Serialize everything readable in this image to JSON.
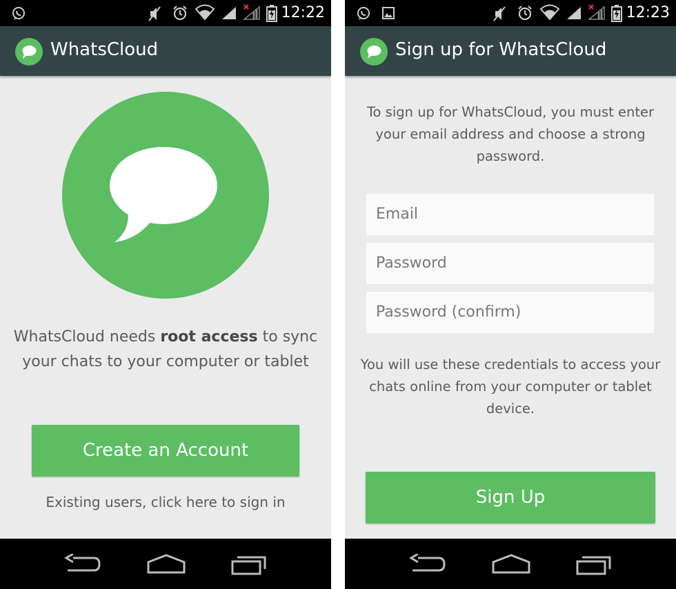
{
  "colors": {
    "accent_green": "#5cbd63",
    "action_bar": "#324446",
    "background": "#ebebeb",
    "field_background": "#fafafa"
  },
  "left_screen": {
    "status_bar": {
      "time": "12:22",
      "icons": [
        "whatsapp-icon",
        "mute-icon",
        "alarm-icon",
        "wifi-icon",
        "signal-icon",
        "signal-x-icon",
        "battery-icon"
      ]
    },
    "action_bar": {
      "title": "WhatsCloud",
      "logo_icon": "chat-bubble-icon"
    },
    "hero_icon": "chat-bubble-icon",
    "intro": {
      "prefix": "WhatsCloud needs ",
      "bold": "root access",
      "suffix": " to sync your chats to your computer or tablet"
    },
    "create_button": "Create an Account",
    "signin_link": "Existing users, click here to sign in",
    "nav_bar": {
      "icons": [
        "back-icon",
        "home-icon",
        "recent-apps-icon"
      ]
    }
  },
  "right_screen": {
    "status_bar": {
      "time": "12:23",
      "icons": [
        "whatsapp-icon",
        "image-icon",
        "mute-icon",
        "alarm-icon",
        "wifi-icon",
        "signal-icon",
        "signal-x-icon",
        "battery-icon"
      ]
    },
    "action_bar": {
      "title": "Sign up for WhatsCloud",
      "logo_icon": "chat-bubble-icon"
    },
    "description": "To sign up for WhatsCloud, you must enter your email address and choose a strong password.",
    "form": {
      "email_placeholder": "Email",
      "password_placeholder": "Password",
      "confirm_placeholder": "Password (confirm)"
    },
    "note": "You will use these credentials to access your chats online from your computer or tablet device.",
    "signup_button": "Sign Up",
    "nav_bar": {
      "icons": [
        "back-icon",
        "home-icon",
        "recent-apps-icon"
      ]
    }
  }
}
